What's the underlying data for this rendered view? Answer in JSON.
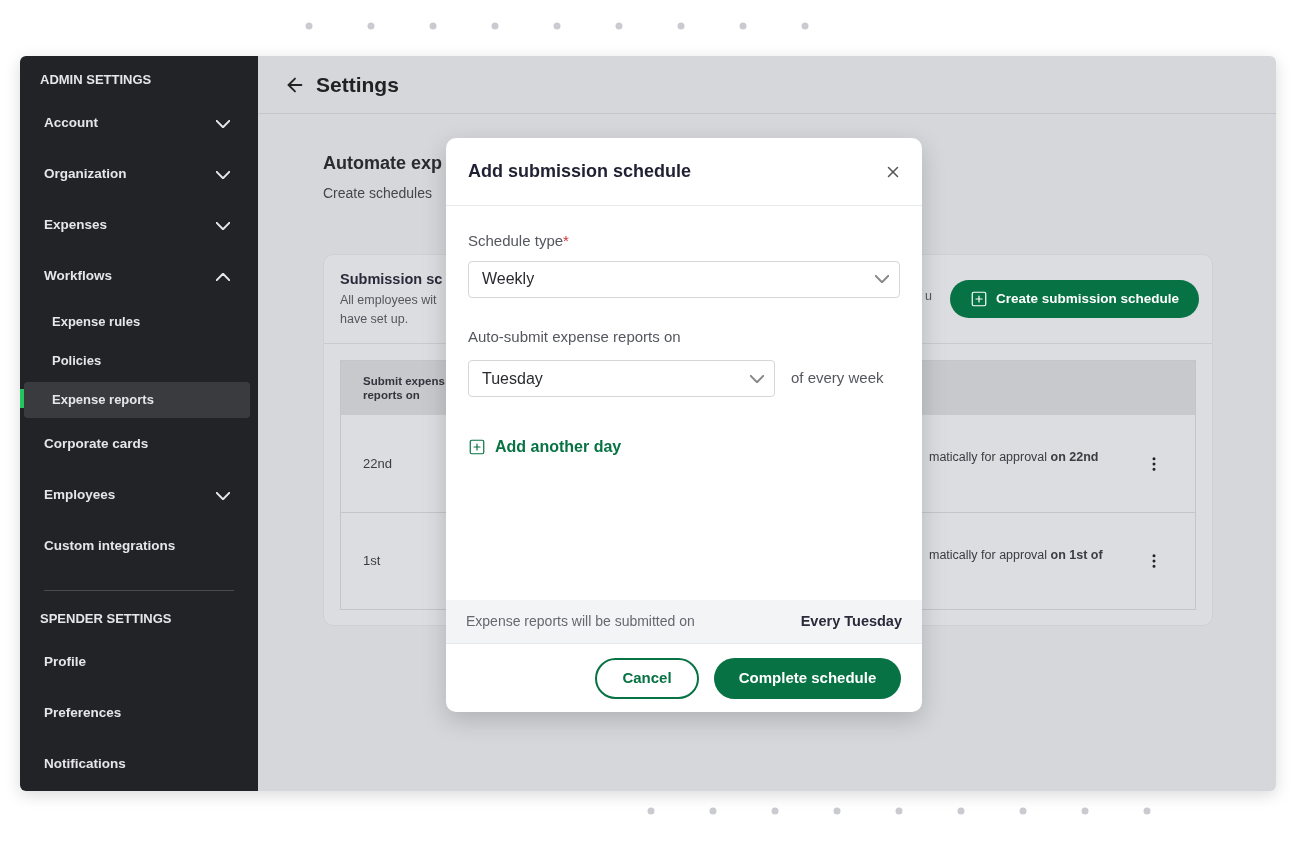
{
  "sidebar": {
    "sections": [
      {
        "heading": "ADMIN SETTINGS",
        "items": [
          {
            "label": "Account",
            "expanded": false,
            "selected": false
          },
          {
            "label": "Organization",
            "expanded": false,
            "selected": false
          },
          {
            "label": "Expenses",
            "expanded": false,
            "selected": false
          },
          {
            "label": "Workflows",
            "expanded": true,
            "selected": false,
            "children": [
              {
                "label": "Expense rules",
                "selected": false
              },
              {
                "label": "Policies",
                "selected": false
              },
              {
                "label": "Expense reports",
                "selected": true
              }
            ]
          },
          {
            "label": "Corporate cards",
            "selected": false
          },
          {
            "label": "Employees",
            "expanded": false,
            "selected": false
          },
          {
            "label": "Custom integrations",
            "selected": false
          }
        ]
      },
      {
        "heading": "SPENDER SETTINGS",
        "items": [
          {
            "label": "Profile",
            "selected": false
          },
          {
            "label": "Preferences",
            "selected": false
          },
          {
            "label": "Notifications",
            "selected": false
          }
        ]
      }
    ]
  },
  "header": {
    "title": "Settings"
  },
  "page": {
    "title": "Automate exp",
    "subtitle": "Create schedules"
  },
  "card": {
    "title": "Submission sc",
    "description_lines": [
      "All employees wit",
      "have set up."
    ],
    "description_tail": "u",
    "button": "Create submission schedule"
  },
  "table": {
    "column_1": [
      "Submit expens",
      "reports on"
    ],
    "rows": [
      {
        "column_1": "22nd",
        "column_2": "matically for approval **on 22nd**"
      },
      {
        "column_1": "1st",
        "column_2": "matically for approval **on 1st of**"
      }
    ]
  },
  "modal": {
    "title": "Add submission schedule",
    "schedule_type": {
      "label": "Schedule type",
      "required_mark": "*",
      "value": "Weekly"
    },
    "day": {
      "label": "Auto-submit expense reports on",
      "value": "Tuesday",
      "suffix": "of every week"
    },
    "add_link": "Add another day",
    "summary": {
      "label": "Expense reports will be submitted on",
      "value": "Every Tuesday"
    },
    "buttons": {
      "cancel": "Cancel",
      "confirm": "Complete schedule"
    }
  }
}
